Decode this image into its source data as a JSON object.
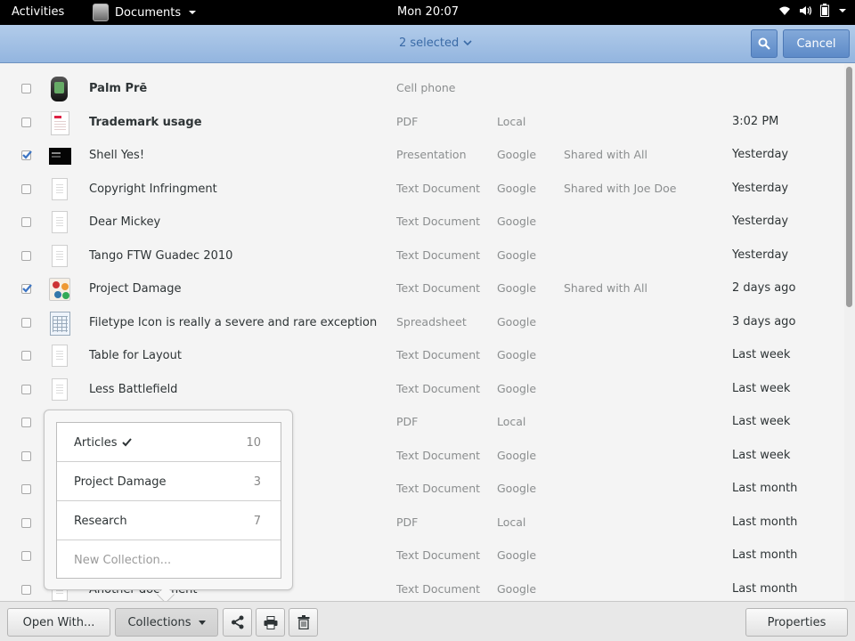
{
  "topbar": {
    "activities": "Activities",
    "app_name": "Documents",
    "clock": "Mon 20:07",
    "icons": [
      "wifi-icon",
      "volume-icon",
      "battery-icon"
    ]
  },
  "header": {
    "selection_label": "2 selected",
    "cancel_label": "Cancel",
    "accent_color": "#93b5df"
  },
  "rows": [
    {
      "title": "Palm Prē",
      "bold": true,
      "type": "Cell phone",
      "source": "",
      "sharing": "",
      "date": "",
      "checked": false,
      "thumb": "phone"
    },
    {
      "title": "Trademark usage",
      "bold": true,
      "type": "PDF",
      "source": "Local",
      "sharing": "",
      "date": "3:02 PM",
      "checked": false,
      "thumb": "pdf"
    },
    {
      "title": "Shell Yes!",
      "bold": false,
      "type": "Presentation",
      "source": "Google",
      "sharing": "Shared with All",
      "date": "Yesterday",
      "checked": true,
      "thumb": "pres"
    },
    {
      "title": "Copyright Infringment",
      "bold": false,
      "type": "Text Document",
      "source": "Google",
      "sharing": "Shared with Joe Doe",
      "date": "Yesterday",
      "checked": false,
      "thumb": "doc"
    },
    {
      "title": "Dear Mickey",
      "bold": false,
      "type": "Text Document",
      "source": "Google",
      "sharing": "",
      "date": "Yesterday",
      "checked": false,
      "thumb": "doc"
    },
    {
      "title": "Tango FTW Guadec 2010",
      "bold": false,
      "type": "Text Document",
      "source": "Google",
      "sharing": "",
      "date": "Yesterday",
      "checked": false,
      "thumb": "doc"
    },
    {
      "title": "Project Damage",
      "bold": false,
      "type": "Text Document",
      "source": "Google",
      "sharing": "Shared with All",
      "date": "2 days ago",
      "checked": true,
      "thumb": "img"
    },
    {
      "title": "Filetype Icon is really a severe and rare exception",
      "bold": false,
      "type": "Spreadsheet",
      "source": "Google",
      "sharing": "",
      "date": "3 days ago",
      "checked": false,
      "thumb": "sheet"
    },
    {
      "title": "Table for Layout",
      "bold": false,
      "type": "Text Document",
      "source": "Google",
      "sharing": "",
      "date": "Last week",
      "checked": false,
      "thumb": "doc"
    },
    {
      "title": "Less Battlefield",
      "bold": false,
      "type": "Text Document",
      "source": "Google",
      "sharing": "",
      "date": "Last week",
      "checked": false,
      "thumb": "doc"
    },
    {
      "title": "",
      "bold": false,
      "type": "PDF",
      "source": "Local",
      "sharing": "",
      "date": "Last week",
      "checked": false,
      "thumb": "pdf"
    },
    {
      "title": "",
      "bold": false,
      "type": "Text Document",
      "source": "Google",
      "sharing": "",
      "date": "Last week",
      "checked": false,
      "thumb": "doc"
    },
    {
      "title": "",
      "bold": false,
      "type": "Text Document",
      "source": "Google",
      "sharing": "",
      "date": "Last month",
      "checked": false,
      "thumb": "doc"
    },
    {
      "title": "",
      "bold": false,
      "type": "PDF",
      "source": "Local",
      "sharing": "",
      "date": "Last month",
      "checked": false,
      "thumb": "pdf"
    },
    {
      "title": "",
      "bold": false,
      "type": "Text Document",
      "source": "Google",
      "sharing": "",
      "date": "Last month",
      "checked": false,
      "thumb": "doc"
    },
    {
      "title": "Another document",
      "bold": false,
      "type": "Text Document",
      "source": "Google",
      "sharing": "",
      "date": "Last month",
      "checked": false,
      "thumb": "doc"
    }
  ],
  "collections_popover": {
    "items": [
      {
        "name": "Articles",
        "count": "10",
        "checked": true
      },
      {
        "name": "Project Damage",
        "count": "3",
        "checked": false
      },
      {
        "name": "Research",
        "count": "7",
        "checked": false
      }
    ],
    "new_collection_placeholder": "New Collection..."
  },
  "toolbar": {
    "open_with_label": "Open With...",
    "collections_label": "Collections",
    "properties_label": "Properties",
    "icons": [
      "share-icon",
      "print-icon",
      "trash-icon"
    ]
  }
}
